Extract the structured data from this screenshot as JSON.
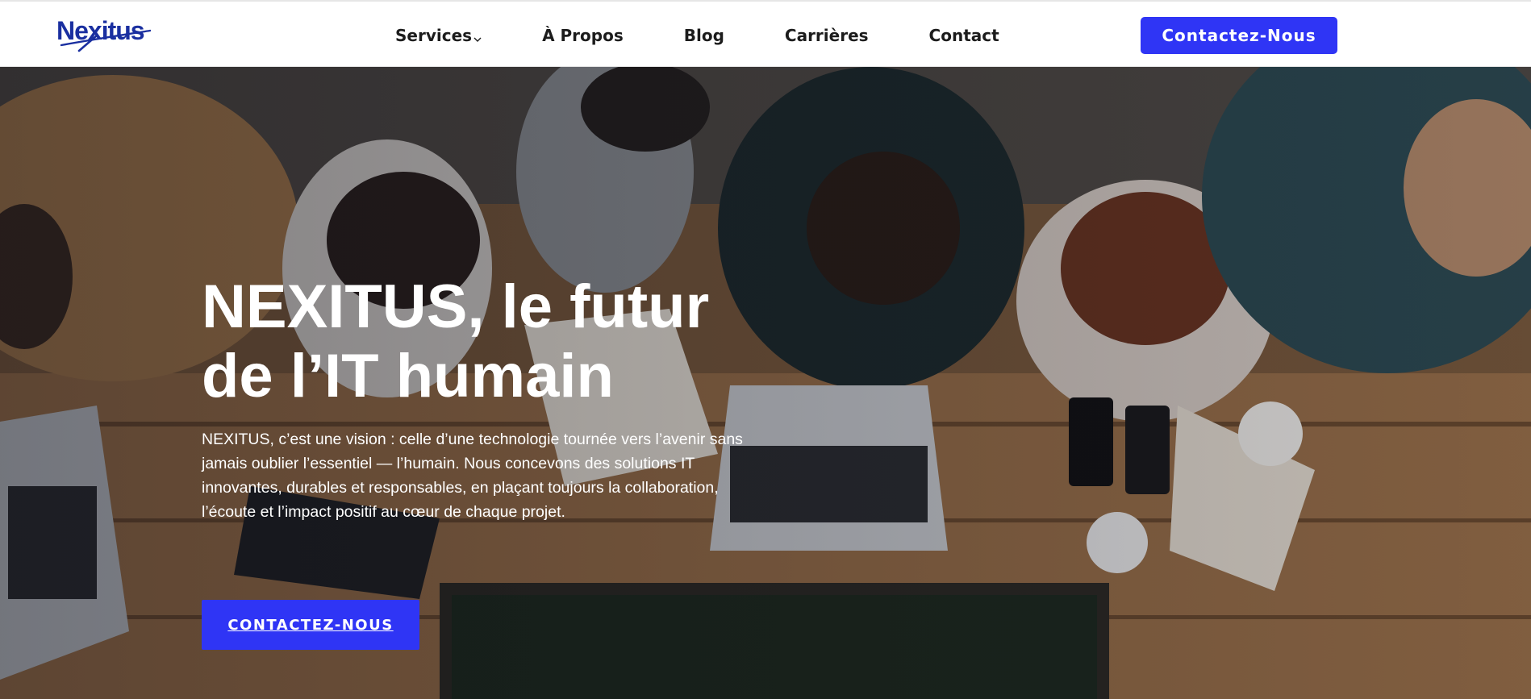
{
  "brand": {
    "logo_text": "Nexitus",
    "logo_color": "#1a2fa0"
  },
  "nav": {
    "items": [
      {
        "label": "Services",
        "has_dropdown": true,
        "icon": "chevron-down-icon"
      },
      {
        "label": "À Propos"
      },
      {
        "label": "Blog"
      },
      {
        "label": "Carrières"
      },
      {
        "label": "Contact"
      }
    ],
    "cta_label": "Contactez-Nous"
  },
  "hero": {
    "title_line1": "NEXITUS, le futur",
    "title_line2": "de l’IT humain",
    "description": "NEXITUS, c’est une vision : celle d’une technologie tournée vers l’avenir sans jamais oublier l’essentiel — l’humain. Nous concevons des solutions IT innovantes, durables et responsables, en plaçant toujours la collaboration, l’écoute et l’impact positif au cœur de chaque projet.",
    "cta_label": "CONTACTEZ-NOUS",
    "background_image": "overhead-team-meeting-photo"
  },
  "colors": {
    "accent": "#2f35f5",
    "nav_text": "#1c1c1c",
    "hero_text": "#ffffff"
  }
}
